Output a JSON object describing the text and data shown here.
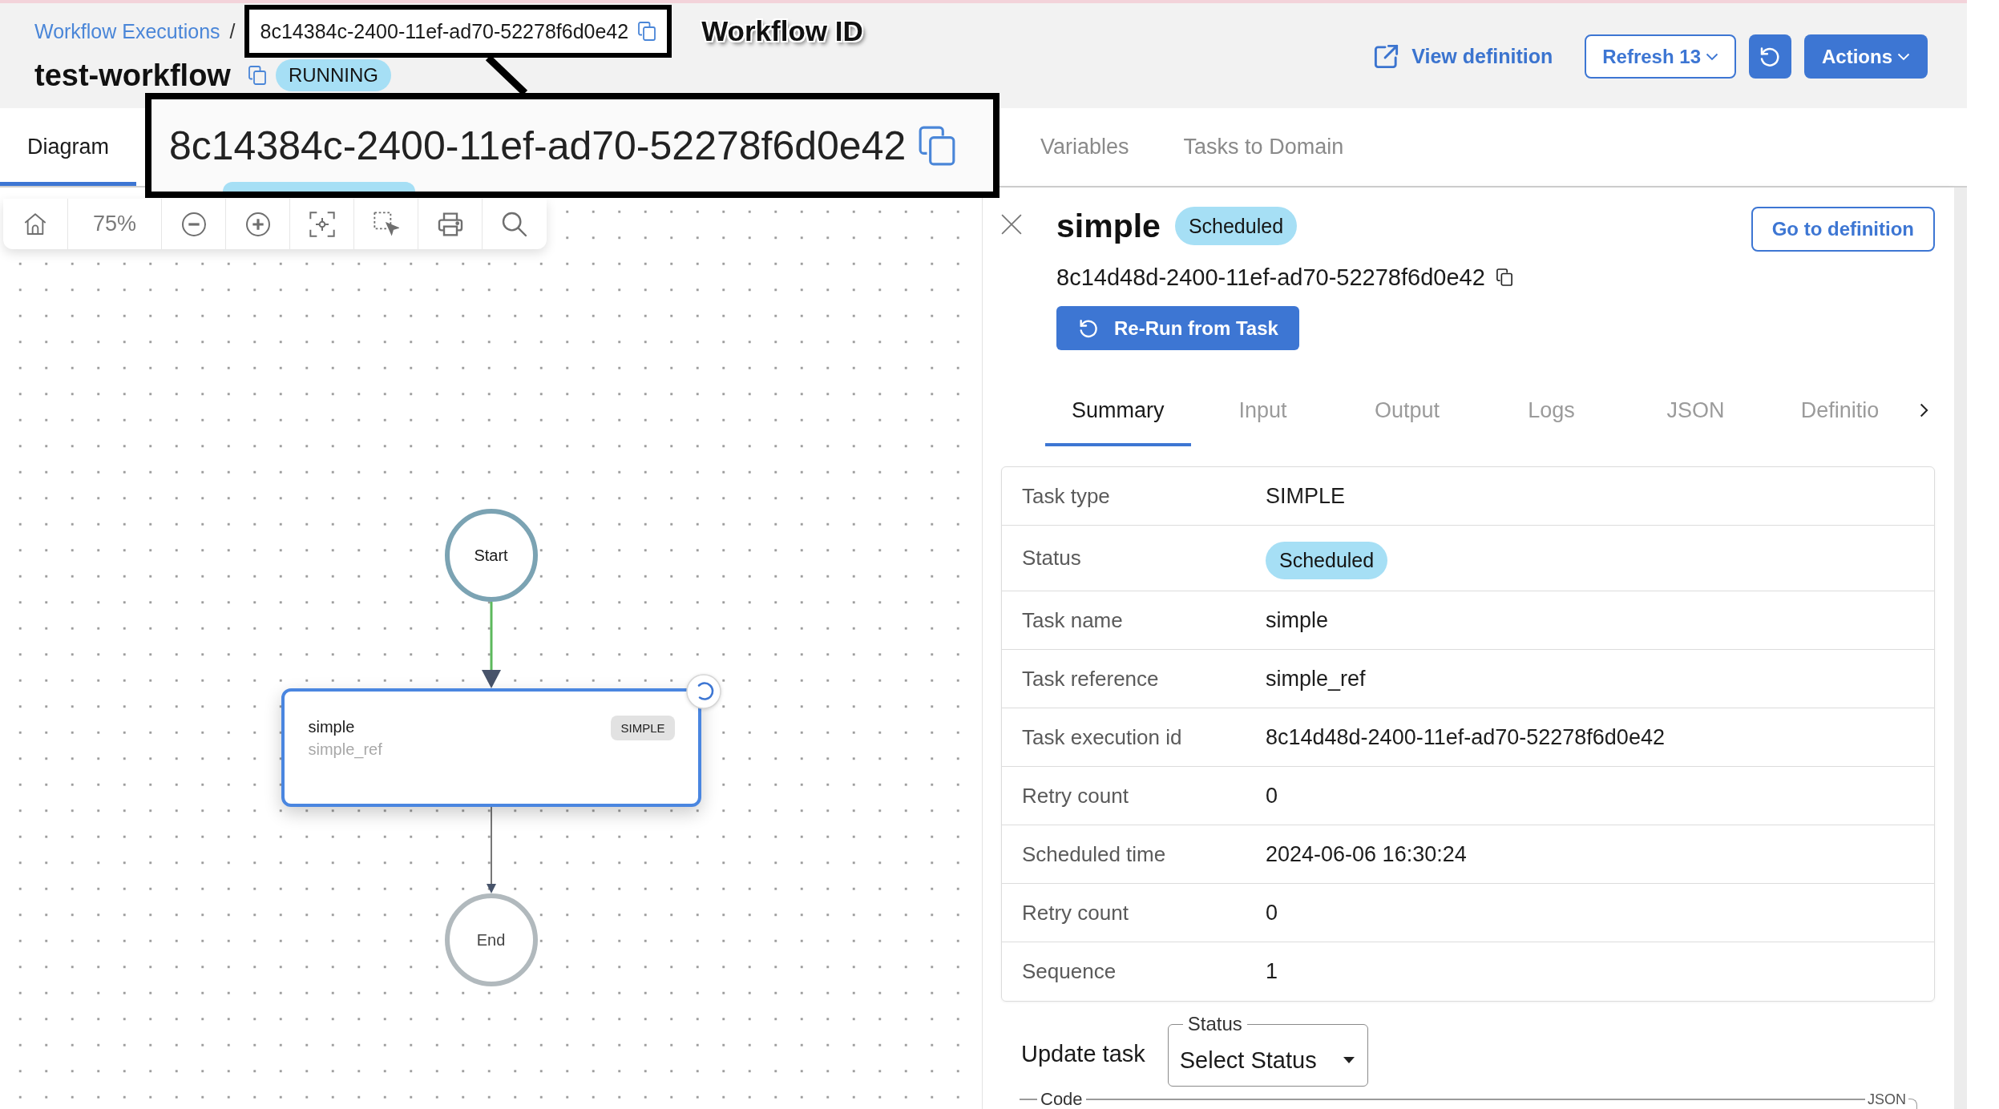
{
  "breadcrumb": {
    "link": "Workflow Executions",
    "separator": "/",
    "current_id": "8c14384c-2400-11ef-ad70-52278f6d0e42"
  },
  "callout": {
    "label": "Workflow ID",
    "zoomed_id": "8c14384c-2400-11ef-ad70-52278f6d0e42"
  },
  "workflow": {
    "title": "test-workflow",
    "status": "RUNNING"
  },
  "header_actions": {
    "view_definition": "View definition",
    "refresh": "Refresh 13",
    "actions": "Actions"
  },
  "tabs": [
    {
      "label": "Diagram",
      "selected": true
    },
    {
      "label": "Variables",
      "selected": false
    },
    {
      "label": "Tasks to Domain",
      "selected": false
    }
  ],
  "diagram": {
    "toolbar": [
      {
        "kind": "home"
      },
      {
        "kind": "zoom",
        "label": "75%"
      },
      {
        "kind": "zoom_out"
      },
      {
        "kind": "zoom_in"
      },
      {
        "kind": "fit"
      },
      {
        "kind": "select"
      },
      {
        "kind": "print"
      },
      {
        "kind": "search"
      }
    ],
    "nodes": [
      {
        "kind": "start",
        "label": "Start",
        "completed": true
      },
      {
        "kind": "task",
        "name": "simple",
        "reference": "simple_ref",
        "type": "SIMPLE",
        "selected": true,
        "in_progress": true
      },
      {
        "kind": "end",
        "label": "End",
        "completed": false
      }
    ],
    "edges": [
      {
        "executed": true
      },
      {
        "executed": false
      }
    ]
  },
  "task_panel": {
    "title": "simple",
    "status": "Scheduled",
    "task_id": "8c14d48d-2400-11ef-ad70-52278f6d0e42",
    "go_to_definition": "Go to definition",
    "rerun": "Re-Run from Task",
    "tabs": [
      {
        "label": "Summary",
        "selected": true
      },
      {
        "label": "Input",
        "selected": false
      },
      {
        "label": "Output",
        "selected": false
      },
      {
        "label": "Logs",
        "selected": false
      },
      {
        "label": "JSON",
        "selected": false
      },
      {
        "label": "Definitio",
        "selected": false
      }
    ],
    "summary": [
      {
        "label": "Task type",
        "value": "SIMPLE",
        "kind": "text"
      },
      {
        "label": "Status",
        "value": "Scheduled",
        "kind": "badge"
      },
      {
        "label": "Task name",
        "value": "simple",
        "kind": "text"
      },
      {
        "label": "Task reference",
        "value": "simple_ref",
        "kind": "text"
      },
      {
        "label": "Task execution id",
        "value": "8c14d48d-2400-11ef-ad70-52278f6d0e42",
        "kind": "text"
      },
      {
        "label": "Retry count",
        "value": "0",
        "kind": "text"
      },
      {
        "label": "Scheduled time",
        "value": "2024-06-06 16:30:24",
        "kind": "text"
      },
      {
        "label": "Retry count",
        "value": "0",
        "kind": "text"
      },
      {
        "label": "Sequence",
        "value": "1",
        "kind": "text"
      }
    ],
    "update_task": {
      "label": "Update task",
      "select_label": "Status",
      "select_value": "Select Status"
    },
    "code_editor": {
      "label": "Code",
      "language": "JSON"
    }
  }
}
